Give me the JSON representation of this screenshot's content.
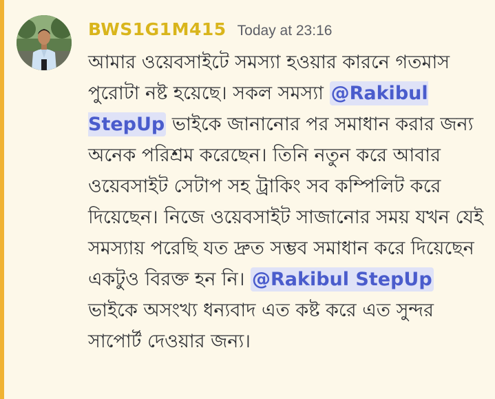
{
  "message": {
    "username": "BWS1G1M415",
    "timestamp": "Today at 23:16",
    "segments": [
      {
        "type": "text",
        "text": "আমার ওয়েবসাইটে সমস্যা হওয়ার কারনে গতমাস পুরোটা নষ্ট হয়েছে। সকল সমস্যা "
      },
      {
        "type": "mention",
        "text": "@Rakibul StepUp"
      },
      {
        "type": "text",
        "text": " ভাইকে জানানোর পর সমাধান করার জন্য অনেক পরিশ্রম করেছেন। তিনি নতুন করে আবার ওয়েবসাইট সেটাপ সহ ট্রাকিং সব কম্পিলিট করে দিয়েছেন। নিজে ওয়েবসাইট সাজানোর  সময় যখন যেই সমস্যায় পরেছি যত দ্রুত সম্ভব সমাধান করে দিয়েছেন একটুও বিরক্ত হন নি। "
      },
      {
        "type": "mention",
        "text": "@Rakibul StepUp"
      },
      {
        "type": "text",
        "text": " ভাইকে অসংখ্য ধন্যবাদ এত কষ্ট করে এত সুন্দর সাপোর্ট দেওয়ার জন্য।"
      }
    ]
  },
  "colors": {
    "background": "#fdf8e9",
    "highlight_bar": "#f0b232",
    "username": "#d9b51c",
    "mention_bg": "#dfe2f7",
    "mention_text": "#4a5ccc"
  },
  "icons": {
    "avatar": "user-avatar-photo"
  }
}
